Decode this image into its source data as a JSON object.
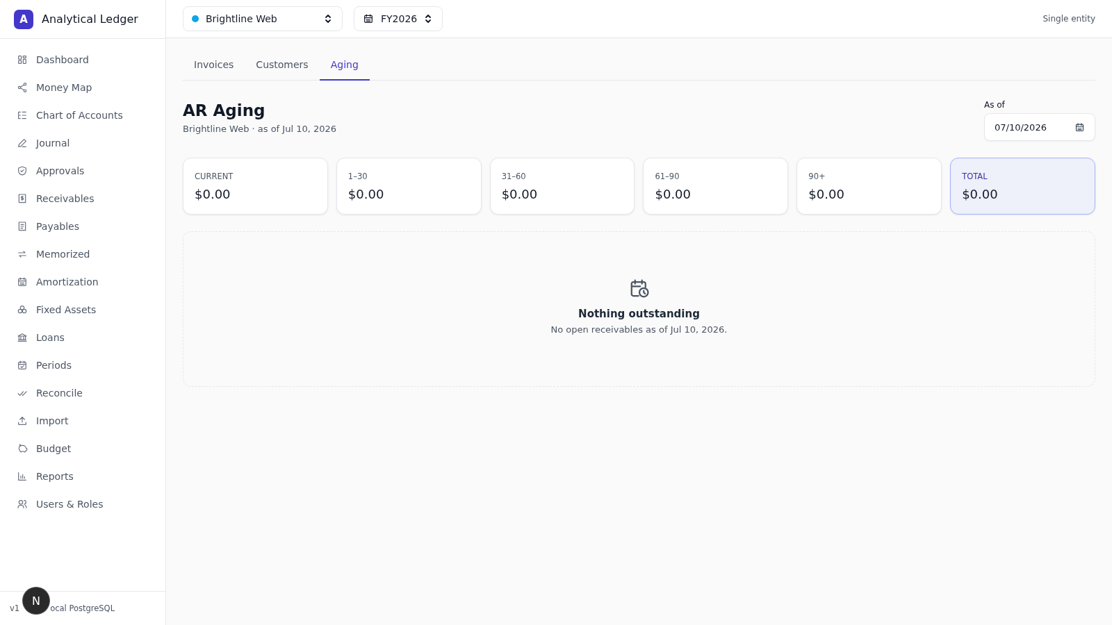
{
  "app": {
    "logo_letter": "A",
    "name": "Analytical Ledger"
  },
  "sidebar": {
    "items": [
      {
        "label": "Dashboard"
      },
      {
        "label": "Money Map"
      },
      {
        "label": "Chart of Accounts"
      },
      {
        "label": "Journal"
      },
      {
        "label": "Approvals"
      },
      {
        "label": "Receivables"
      },
      {
        "label": "Payables"
      },
      {
        "label": "Memorized"
      },
      {
        "label": "Amortization"
      },
      {
        "label": "Fixed Assets"
      },
      {
        "label": "Loans"
      },
      {
        "label": "Periods"
      },
      {
        "label": "Reconcile"
      },
      {
        "label": "Import"
      },
      {
        "label": "Budget"
      },
      {
        "label": "Reports"
      },
      {
        "label": "Users & Roles"
      }
    ],
    "footer": [
      "v1",
      "ocal PostgreSQL"
    ]
  },
  "topbar": {
    "entity": {
      "label": "Brightline Web",
      "color": "#0ea5e9"
    },
    "fiscal_year": "FY2026",
    "mode": "Single entity"
  },
  "tabs": [
    {
      "label": "Invoices",
      "selected": false
    },
    {
      "label": "Customers",
      "selected": false
    },
    {
      "label": "Aging",
      "selected": true
    }
  ],
  "page": {
    "title": "AR Aging",
    "subtitle": "Brightline Web · as of Jul 10, 2026",
    "as_of": {
      "label": "As of",
      "value": "07/10/2026"
    }
  },
  "buckets": [
    {
      "label": "CURRENT",
      "amount": "$0.00",
      "kind": "bucket"
    },
    {
      "label": "1–30",
      "amount": "$0.00",
      "kind": "bucket"
    },
    {
      "label": "31–60",
      "amount": "$0.00",
      "kind": "bucket"
    },
    {
      "label": "61–90",
      "amount": "$0.00",
      "kind": "bucket"
    },
    {
      "label": "90+",
      "amount": "$0.00",
      "kind": "bucket"
    },
    {
      "label": "TOTAL",
      "amount": "$0.00",
      "kind": "total"
    }
  ],
  "empty_state": {
    "title": "Nothing outstanding",
    "message": "No open receivables as of Jul 10, 2026."
  },
  "dev_badge": {
    "letter": "N"
  }
}
